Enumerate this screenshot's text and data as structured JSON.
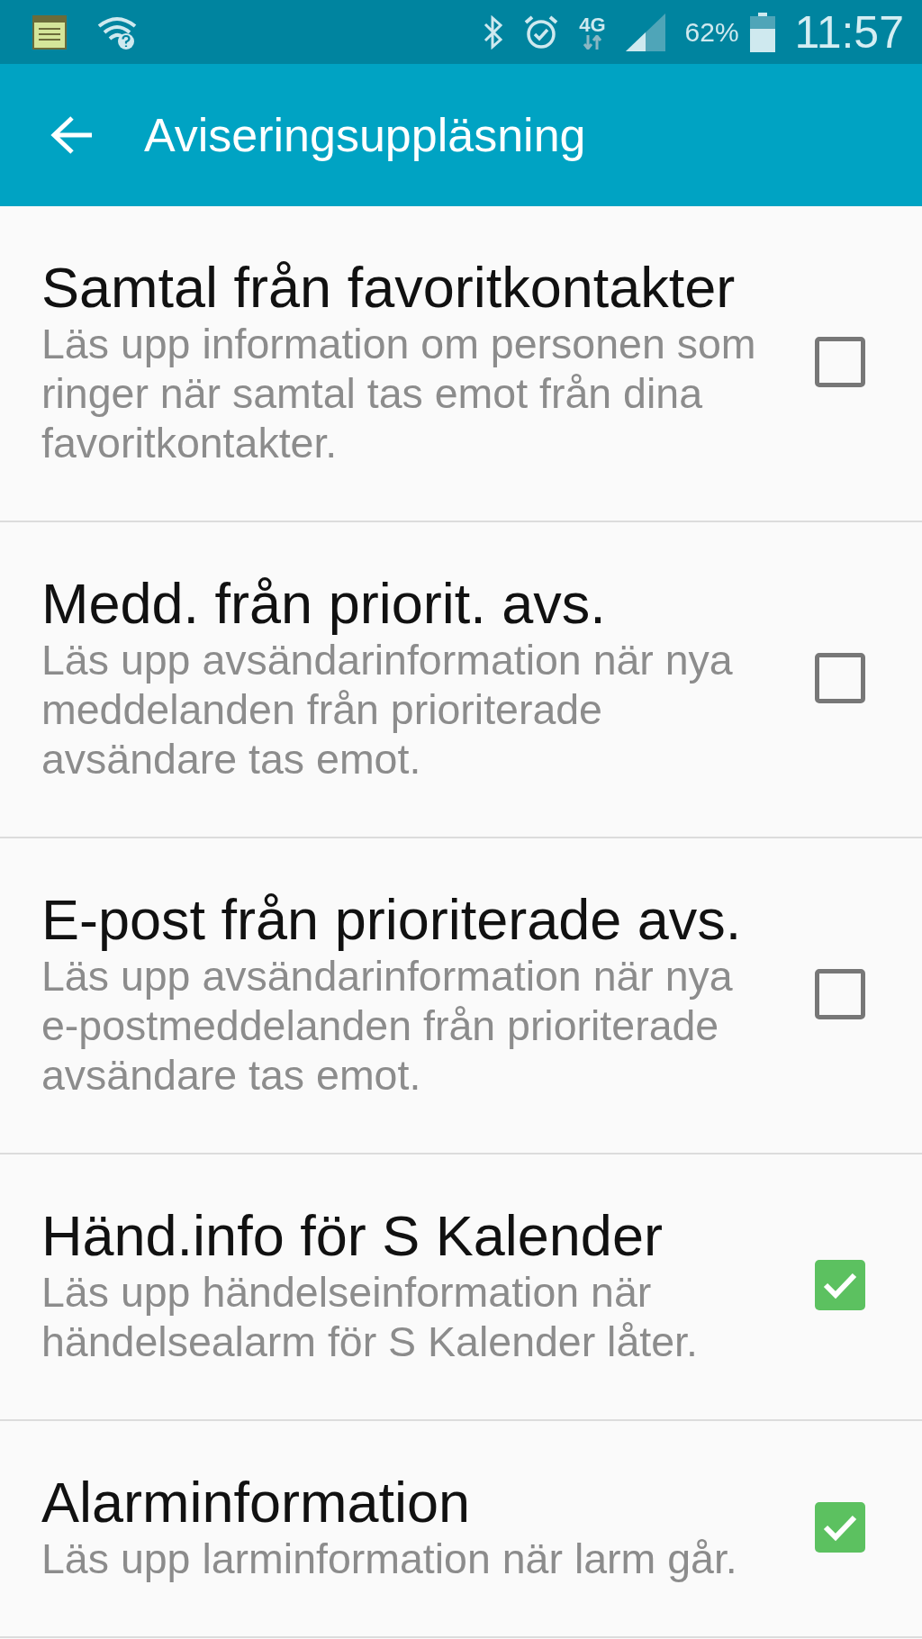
{
  "status_bar": {
    "network": "4G",
    "battery": "62%",
    "time": "11:57"
  },
  "app_bar": {
    "title": "Aviseringsuppläsning"
  },
  "settings": [
    {
      "title": "Samtal från favoritkontakter",
      "summary": "Läs upp information om personen som ringer när samtal tas emot från dina favoritkontakter.",
      "checked": false
    },
    {
      "title": "Medd. från priorit. avs.",
      "summary": "Läs upp avsändarinformation när nya meddelanden från prioriterade avsändare tas emot.",
      "checked": false
    },
    {
      "title": "E-post från prioriterade avs.",
      "summary": "Läs upp avsändarinformation när nya e-postmeddelanden från prioriterade avsändare tas emot.",
      "checked": false
    },
    {
      "title": "Händ.info för S Kalender",
      "summary": "Läs upp händelseinformation när händelsealarm för S Kalender låter.",
      "checked": true
    },
    {
      "title": "Alarminformation",
      "summary": "Läs upp larminformation när larm går.",
      "checked": true
    }
  ]
}
